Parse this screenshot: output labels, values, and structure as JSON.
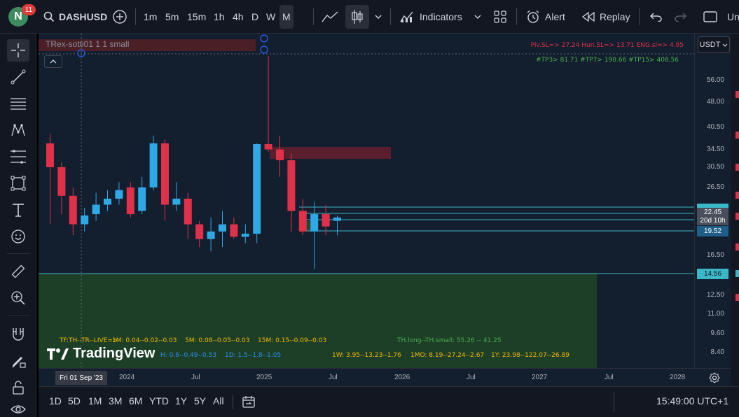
{
  "topbar": {
    "avatar_letter": "N",
    "notification_count": "11",
    "symbol": "DASHUSD",
    "intervals": [
      "1m",
      "5m",
      "15m",
      "1h",
      "4h",
      "D",
      "W",
      "M"
    ],
    "active_interval": "M",
    "indicators_label": "Indicators",
    "alert_label": "Alert",
    "replay_label": "Replay",
    "cut_label": "Un"
  },
  "legend": {
    "series_label": "TRex-sotti01 1 1 small",
    "sl_line": "Piv.SL=> 27.24  Hun.SL=> 13.71  ENG.sl=> 4.95",
    "tp_line": "#TP3> 81.71  #TP7> 190.66  #TP15> 408.56"
  },
  "currency": "USDT",
  "price_axis": {
    "labels": [
      "56.00",
      "48.00",
      "40.50",
      "34.50",
      "30.50",
      "26.50",
      "16.50",
      "12.50",
      "11.00",
      "9.60",
      "8.40"
    ],
    "current_price": "22.45",
    "countdown": "20d 10h",
    "tag_1952": "19.52",
    "tag_1456": "14.56"
  },
  "time_axis": {
    "labels": [
      "2024",
      "Jul",
      "2025",
      "Jul",
      "2026",
      "Jul",
      "2027",
      "Jul",
      "2028"
    ],
    "crosshair_date": "Fri 01 Sep '23"
  },
  "indicator_panel": {
    "tf_line": "TF:TH--TR--LIVE=>",
    "m1": "1M: 0.04--0.02--0.03",
    "m5": "5M: 0.08--0.05--0.03",
    "m15": "15M: 0.15--0.09--0.03",
    "th": "TH.long--TH.small: 55.26 -- 41.25",
    "h1": "H: 0.6--0.49--0.53",
    "d1": "1D: 1.5--1.8--1.05",
    "w1": "1W: 3.95--13.23--1.76",
    "mo1": "1MO: 8.19--27.24--2.67",
    "y1": "1Y: 23.98--122.07--26.89"
  },
  "watermark": "TradingView",
  "bottombar": {
    "ranges": [
      "1D",
      "5D",
      "1M",
      "3M",
      "6M",
      "YTD",
      "1Y",
      "5Y",
      "All"
    ],
    "clock": "15:49:00 UTC+1"
  },
  "colors": {
    "up": "#2fa8e6",
    "down": "#e0314a",
    "background": "#131e2e",
    "zone_green": "#1d4a2c",
    "zone_red": "#5a1f2c",
    "line": "#3bb8c8"
  },
  "chart_data": {
    "type": "candlestick",
    "note_series": "monthly candles DASHUSD",
    "ohlc": [
      [
        36.0,
        38.5,
        20.5,
        30.5
      ],
      [
        30.5,
        31.5,
        22.0,
        25.0
      ],
      [
        25.0,
        26.5,
        19.0,
        20.5
      ],
      [
        20.5,
        23.0,
        19.5,
        21.8
      ],
      [
        22.0,
        25.5,
        21.0,
        23.5
      ],
      [
        23.5,
        26.0,
        22.5,
        24.5
      ],
      [
        24.5,
        27.5,
        23.5,
        26.0
      ],
      [
        26.5,
        27.5,
        21.5,
        22.0
      ],
      [
        22.5,
        28.5,
        22.0,
        26.5
      ],
      [
        26.5,
        38.0,
        26.0,
        36.0
      ],
      [
        36.0,
        37.0,
        21.0,
        23.5
      ],
      [
        23.5,
        27.5,
        22.5,
        24.5
      ],
      [
        24.5,
        25.5,
        18.5,
        20.5
      ],
      [
        20.5,
        21.0,
        17.5,
        18.5
      ],
      [
        18.5,
        21.5,
        17.0,
        19.5
      ],
      [
        19.5,
        22.5,
        17.5,
        20.5
      ],
      [
        20.5,
        21.5,
        18.5,
        18.8
      ],
      [
        18.8,
        20.5,
        18.0,
        19.2
      ],
      [
        19.2,
        36.0,
        18.0,
        35.8
      ],
      [
        35.8,
        66.0,
        34.0,
        34.5
      ],
      [
        34.5,
        38.0,
        28.5,
        32.0
      ],
      [
        32.0,
        33.5,
        19.5,
        22.5
      ],
      [
        22.5,
        24.5,
        19.0,
        19.5
      ],
      [
        19.5,
        24.0,
        15.0,
        22.0
      ],
      [
        22.0,
        23.5,
        19.0,
        20.2
      ],
      [
        21.0,
        21.8,
        19.0,
        21.5
      ]
    ],
    "ylim": [
      7.5,
      70
    ]
  }
}
